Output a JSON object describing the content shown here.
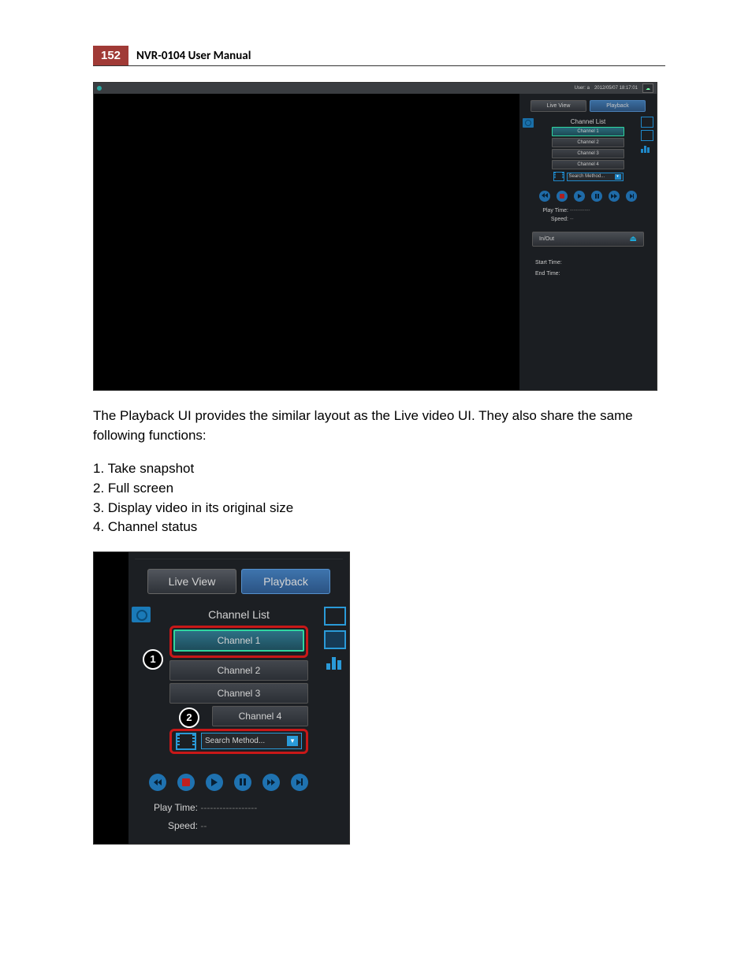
{
  "header": {
    "page_number": "152",
    "title": "NVR-0104  User Manual"
  },
  "screenshot1": {
    "topbar": {
      "user_label": "User: a",
      "datetime": "2012/05/07 18:17:01"
    },
    "tabs": {
      "live": "Live View",
      "playback": "Playback"
    },
    "channel_list_title": "Channel List",
    "channels": [
      "Channel 1",
      "Channel 2",
      "Channel 3",
      "Channel 4"
    ],
    "search_label": "Search Method...",
    "playtime_label": "Play Time:",
    "playtime_value": "-----------",
    "speed_label": "Speed:",
    "speed_value": "--",
    "inout_label": "In/Out",
    "start_label": "Start Time:",
    "end_label": "End Time:"
  },
  "body": {
    "para": "The Playback UI provides the similar layout as the Live video UI. They also share the same following functions:",
    "items": [
      "1. Take snapshot",
      "2. Full screen",
      "3. Display video in its original size",
      "4. Channel status"
    ]
  },
  "screenshot2": {
    "tabs": {
      "live": "Live View",
      "playback": "Playback"
    },
    "channel_list_title": "Channel List",
    "channels": [
      "Channel 1",
      "Channel 2",
      "Channel 3",
      "Channel 4"
    ],
    "search_label": "Search Method...",
    "callout1": "1",
    "callout2": "2",
    "playtime_label": "Play Time:",
    "playtime_value": "------------------",
    "speed_label": "Speed:",
    "speed_value": "--"
  }
}
